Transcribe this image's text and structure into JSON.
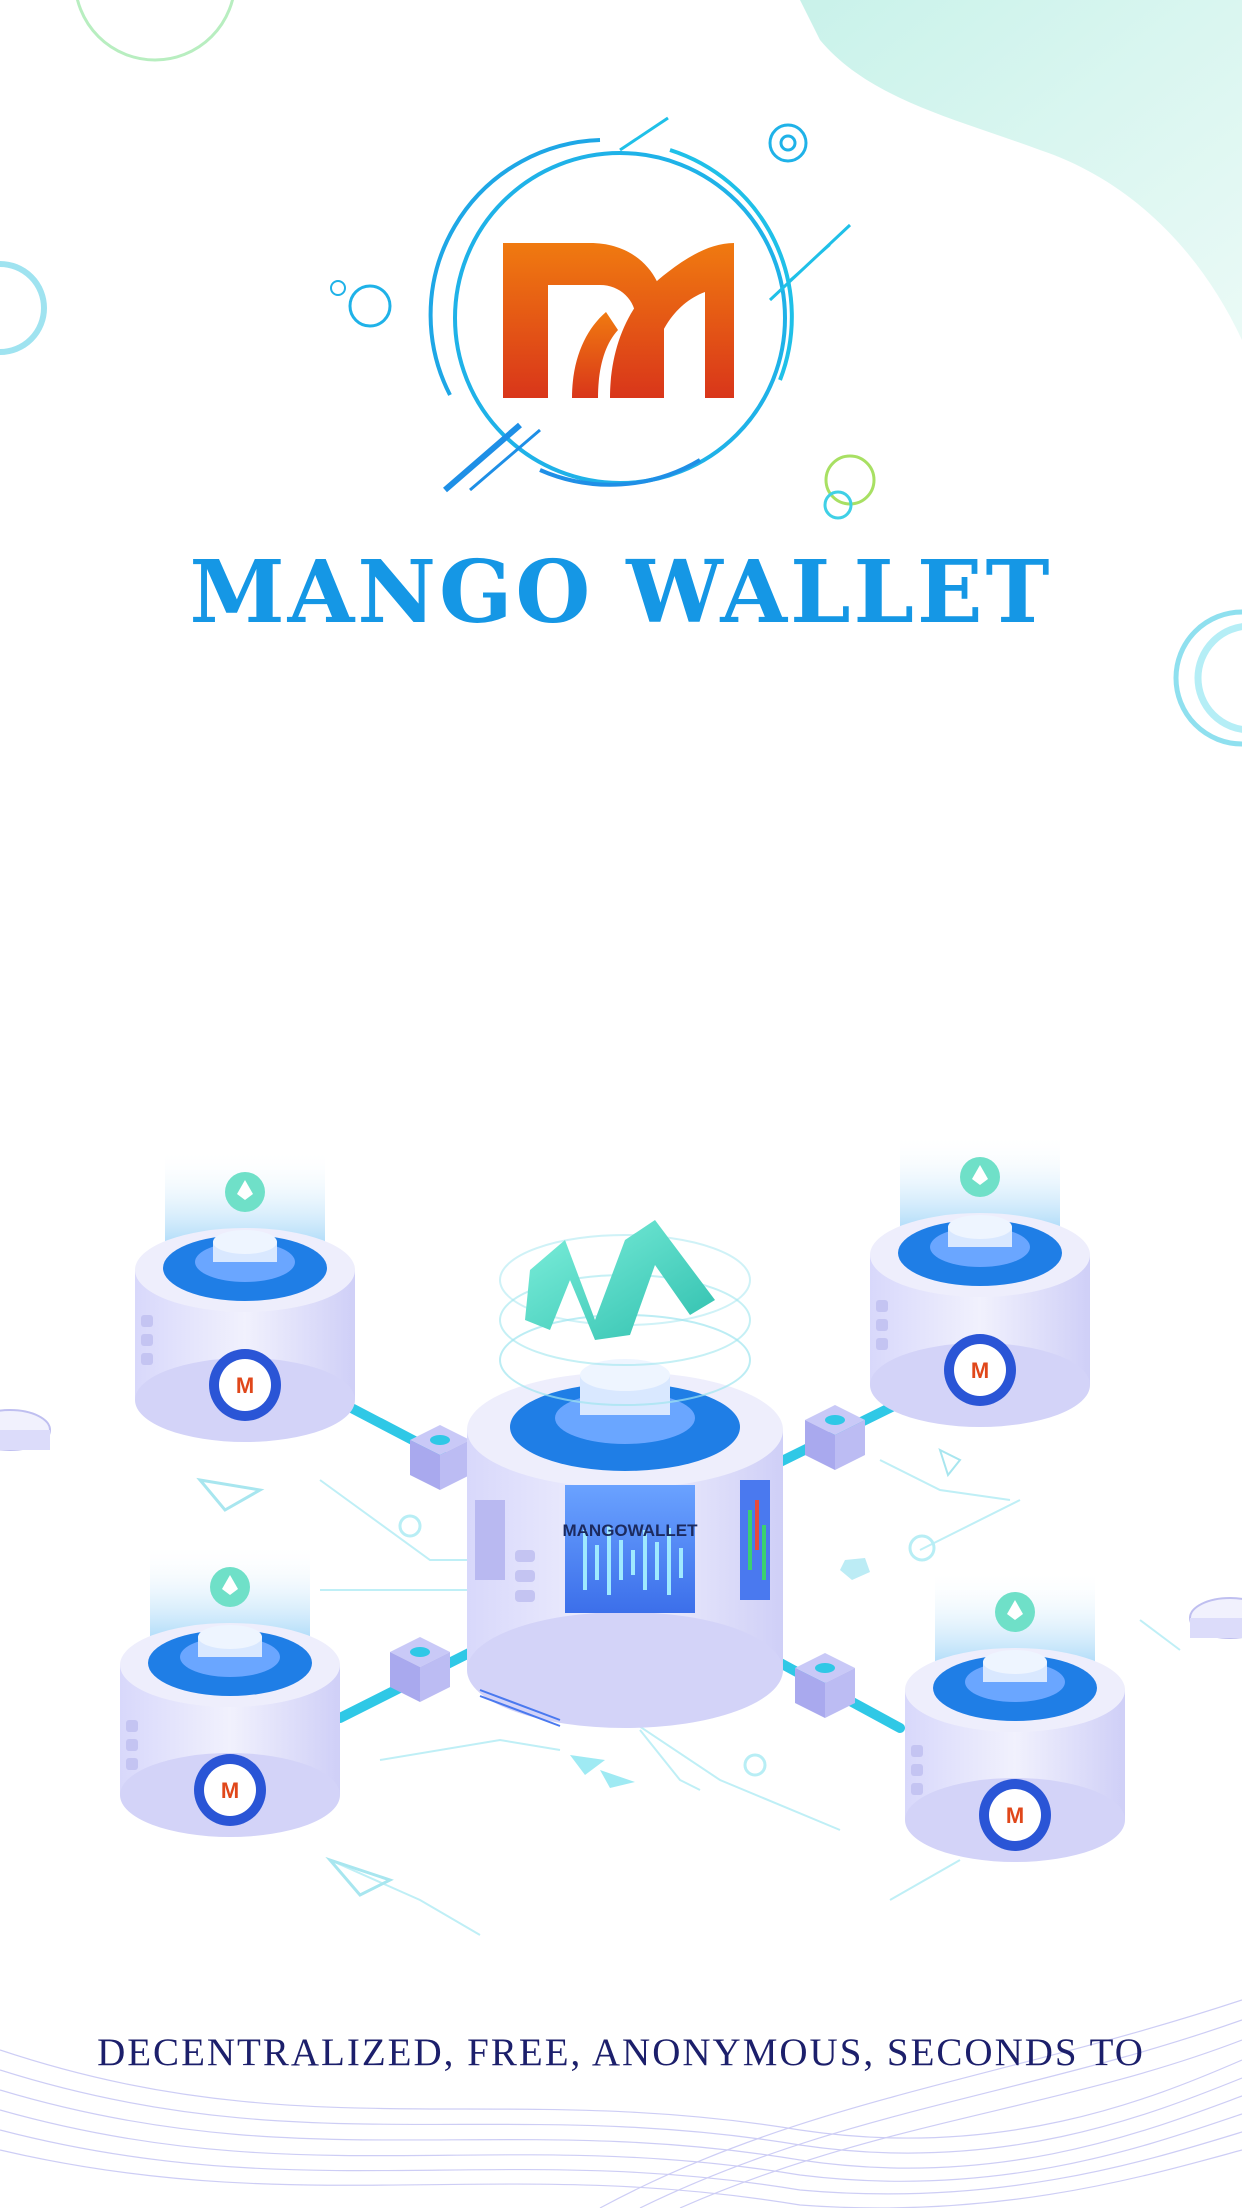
{
  "app": {
    "title": "MANGO WALLET",
    "tagline": "DECENTRALIZED, FREE, ANONYMOUS, SECONDS TO"
  },
  "illustration": {
    "hub_label": "MANGOWALLET",
    "coin_icon": "ethereum-coin-icon",
    "logo_icon": "mango-m-logo-icon"
  },
  "colors": {
    "brand_blue": "#1597e5",
    "logo_orange": "#f07a10",
    "logo_red": "#d9361a",
    "tagline_navy": "#1c1f6b",
    "accent_cyan": "#3fd0e6",
    "teal_blob": "#b8ece3",
    "node_lavender": "#dcdcfa"
  }
}
